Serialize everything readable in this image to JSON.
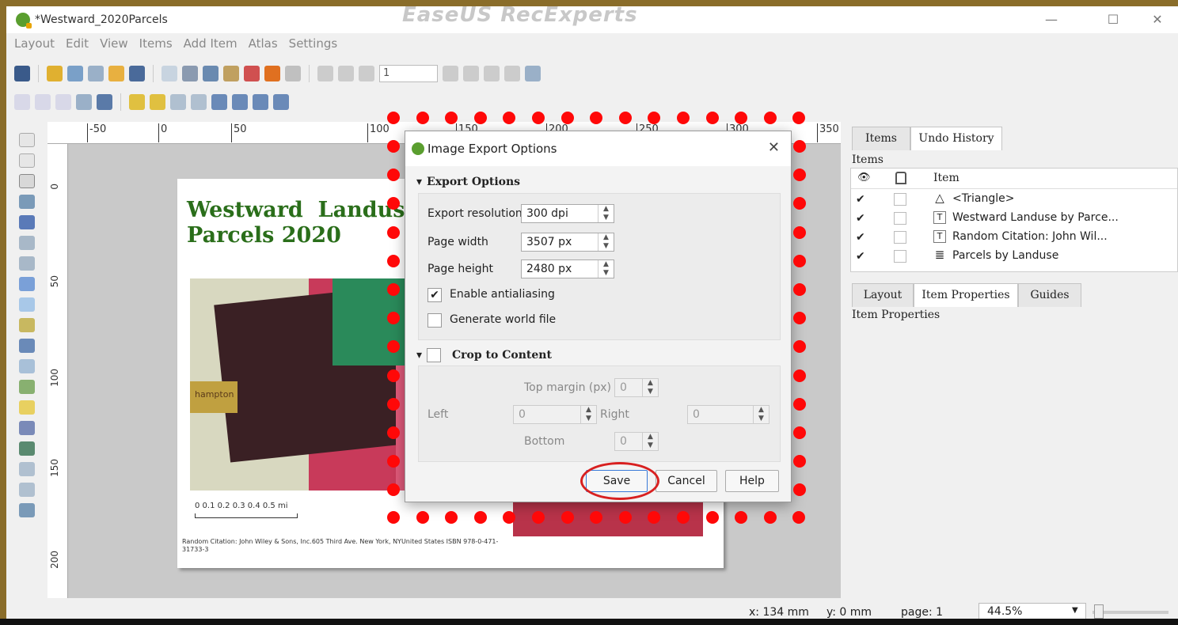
{
  "window": {
    "title": "*Westward_2020Parcels",
    "watermark": "EaseUS RecExperts",
    "minimize": "—",
    "maximize": "☐",
    "close": "✕"
  },
  "menu": [
    "Layout",
    "Edit",
    "View",
    "Items",
    "Add Item",
    "Atlas",
    "Settings"
  ],
  "toolbar": {
    "page_value": "1"
  },
  "ruler": {
    "top": [
      "-50",
      "0",
      "50",
      "100",
      "150",
      "200",
      "250",
      "300",
      "350"
    ],
    "left": [
      "0",
      "50",
      "100",
      "150",
      "200"
    ]
  },
  "layout": {
    "map_title": "Westward  Landuse by\nParcels 2020",
    "scale_labels": "0   0.1  0.2  0.3  0.4  0.5 mi",
    "map_label": "hampton",
    "citation": "Random Citation: John Wiley & Sons, Inc.605 Third Ave. New York, NYUnited States ISBN 978-0-471-31733-3"
  },
  "dialog": {
    "title": "Image Export Options",
    "close": "✕",
    "export_section": "Export Options",
    "resolution_label": "Export resolution",
    "resolution_value": "300 dpi",
    "width_label": "Page width",
    "width_value": "3507 px",
    "height_label": "Page height",
    "height_value": "2480 px",
    "antialias_label": "Enable antialiasing",
    "antialias_checked": true,
    "worldfile_label": "Generate world file",
    "worldfile_checked": false,
    "crop_section": "Crop to Content",
    "crop_checked": false,
    "top_margin_label": "Top margin (px)",
    "top_margin_value": "0",
    "left_label": "Left",
    "left_value": "0",
    "right_label": "Right",
    "right_value": "0",
    "bottom_label": "Bottom",
    "bottom_value": "0",
    "save": "Save",
    "cancel": "Cancel",
    "help": "Help"
  },
  "rpanel": {
    "tab_items": "Items",
    "tab_undo": "Undo History",
    "items_heading": "Items",
    "col_item": "Item",
    "items": [
      {
        "name": "<Triangle>",
        "icon": "triangle-icon",
        "glyph": "△",
        "visible": true
      },
      {
        "name": "Westward Landuse by Parce...",
        "icon": "text-icon",
        "glyph": "T",
        "visible": true
      },
      {
        "name": "Random Citation: John Wil...",
        "icon": "text-icon",
        "glyph": "T",
        "visible": true
      },
      {
        "name": "Parcels by Landuse",
        "icon": "legend-icon",
        "glyph": "≣",
        "visible": true
      }
    ],
    "tab_layout": "Layout",
    "tab_props": "Item Properties",
    "tab_guides": "Guides",
    "props_heading": "Item Properties"
  },
  "status": {
    "x": "x: 134 mm",
    "y": "y: 0 mm",
    "page": "page: 1",
    "zoom": "44.5%"
  },
  "colors": {
    "qgis_green": "#5a9e2f",
    "highlight_red": "#ff0808",
    "title_green": "#2a6e1a"
  }
}
